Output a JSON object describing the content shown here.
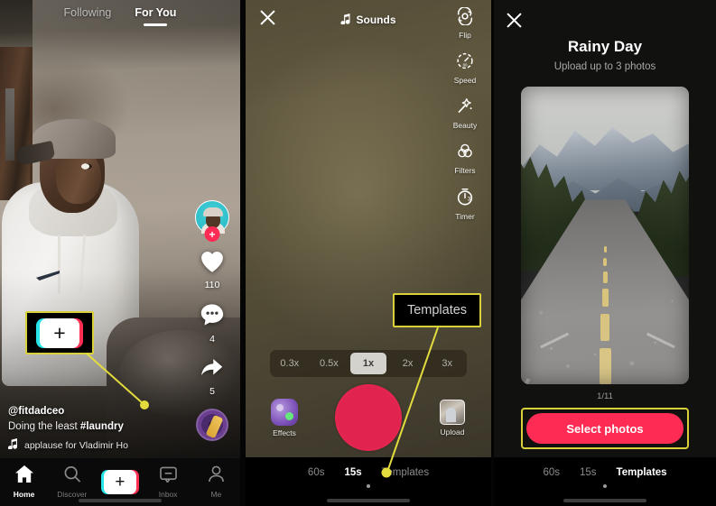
{
  "feed": {
    "tabs": [
      {
        "label": "Following",
        "active": false
      },
      {
        "label": "For You",
        "active": true
      }
    ],
    "rail": {
      "avatar_name": "creator-avatar",
      "follow_label": "+",
      "like_count": "110",
      "comment_count": "4",
      "share_count": "5"
    },
    "caption": {
      "username": "@fitdadceo",
      "text": "Doing the least ",
      "hashtag": "#laundry",
      "music": "applause for Vladimir Ho"
    },
    "nav": [
      {
        "label": "Home",
        "icon": "home-icon",
        "active": true
      },
      {
        "label": "Discover",
        "icon": "search-icon",
        "active": false
      },
      {
        "label": "",
        "icon": "create-plus-icon",
        "active": false
      },
      {
        "label": "Inbox",
        "icon": "inbox-icon",
        "active": false
      },
      {
        "label": "Me",
        "icon": "person-icon",
        "active": false
      }
    ]
  },
  "camera": {
    "close_label": "✕",
    "sounds_label": "Sounds",
    "tools": [
      {
        "label": "Flip",
        "icon": "flip-camera-icon"
      },
      {
        "label": "Speed",
        "icon": "speedometer-icon"
      },
      {
        "label": "Beauty",
        "icon": "magic-wand-icon"
      },
      {
        "label": "Filters",
        "icon": "filters-circles-icon"
      },
      {
        "label": "Timer",
        "icon": "timer-icon"
      }
    ],
    "speeds": [
      {
        "label": "0.3x",
        "active": false
      },
      {
        "label": "0.5x",
        "active": false
      },
      {
        "label": "1x",
        "active": true
      },
      {
        "label": "2x",
        "active": false
      },
      {
        "label": "3x",
        "active": false
      }
    ],
    "effects_label": "Effects",
    "upload_label": "Upload",
    "record_label": "",
    "modes": [
      {
        "label": "60s",
        "active": false
      },
      {
        "label": "15s",
        "active": true
      },
      {
        "label": "Templates",
        "active": false
      }
    ]
  },
  "template": {
    "close_label": "✕",
    "title": "Rainy Day",
    "subtitle": "Upload up to 3 photos",
    "counter": "1/11",
    "select_button": "Select photos",
    "modes": [
      {
        "label": "60s",
        "active": false
      },
      {
        "label": "15s",
        "active": false
      },
      {
        "label": "Templates",
        "active": true
      }
    ]
  },
  "annotations": {
    "callout_label": "Templates",
    "highlight_color": "#d9d13c",
    "accent_color": "#fe2c55",
    "cyan_color": "#28e3e8"
  }
}
